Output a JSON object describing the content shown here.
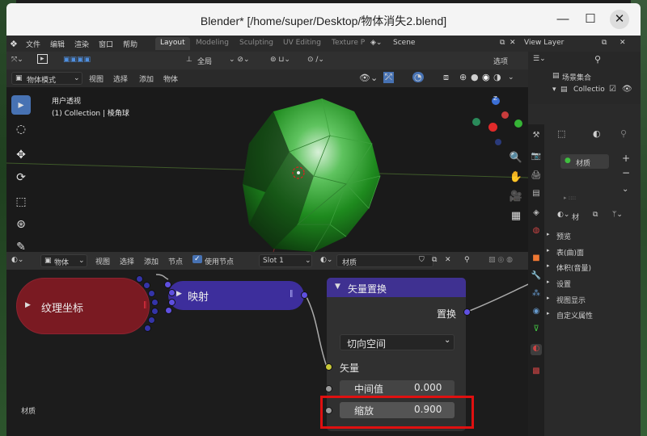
{
  "window": {
    "title": "Blender* [/home/super/Desktop/物体消失2.blend]",
    "minimize": "—",
    "maximize": "☐",
    "close": "✕"
  },
  "menubar": {
    "items": [
      "文件",
      "编辑",
      "渲染",
      "窗口",
      "帮助"
    ],
    "workspaces": [
      "Layout",
      "Modeling",
      "Sculpting",
      "UV Editing",
      "Texture P"
    ],
    "scene_label": "Scene",
    "viewlayer_label": "View Layer"
  },
  "viewport_header": {
    "orientation": "全局",
    "options": "选项",
    "mode": "物体模式",
    "menus": [
      "视图",
      "选择",
      "添加",
      "物体"
    ]
  },
  "viewport": {
    "view_name": "用户透视",
    "collection_info": "(1) Collection | 棱角球",
    "gizmo_z": "Z",
    "gizmo_y": "Y",
    "gizmo_x": "X"
  },
  "outliner": {
    "scene_collection": "场景集合",
    "collection": "Collectio"
  },
  "properties": {
    "material_slot": "材质",
    "material_name": "材",
    "sections": [
      "预览",
      "表(曲)面",
      "体积(音量)",
      "设置",
      "视图显示",
      "自定义属性"
    ]
  },
  "node_editor_header": {
    "type": "物体",
    "menus": [
      "视图",
      "选择",
      "添加",
      "节点"
    ],
    "use_nodes": "使用节点",
    "slot": "Slot 1",
    "material": "材质"
  },
  "nodes": {
    "tex_coord": {
      "title": "纹理坐标",
      "color": "#7a1a22"
    },
    "mapping": {
      "title": "映射",
      "color": "#3d2e9c"
    },
    "vector_disp": {
      "title": "矢量置换",
      "output_label": "置换",
      "space": "切向空间",
      "input_vector": "矢量",
      "midlevel_label": "中间值",
      "midlevel_value": "0.000",
      "scale_label": "缩放",
      "scale_value": "0.900"
    }
  },
  "footer_label": "材质",
  "colors": {
    "accent": "#4772b3",
    "highlight": "#e01010",
    "sphere_green": "#2fae2f"
  }
}
